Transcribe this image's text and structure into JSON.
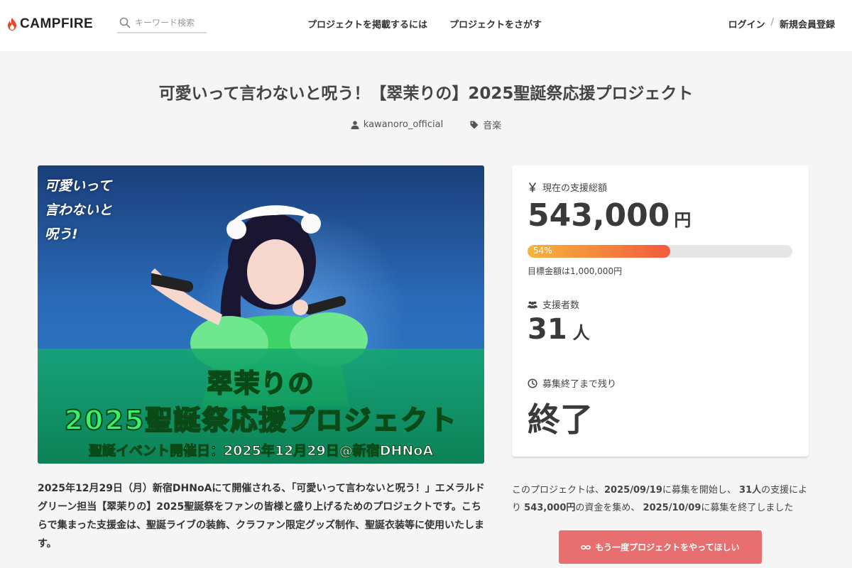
{
  "header": {
    "logo_text": "CAMPFIRE",
    "search_placeholder": "キーワード検索",
    "nav": {
      "post_project": "プロジェクトを掲載するには",
      "find_project": "プロジェクトをさがす"
    },
    "login": "ログイン",
    "separator": "/",
    "signup": "新規会員登録"
  },
  "project": {
    "title": "可愛いって言わないと呪う！【翠茉りの】2025聖誕祭応援プロジェクト",
    "owner": "kawanoro_official",
    "category": "音楽",
    "image": {
      "logo_text": [
        "可愛いって",
        "言わないと",
        "呪う!"
      ],
      "headline_line1": "翠茉りの",
      "headline_line2": "2025聖誕祭応援プロジェクト",
      "event_line": "聖誕イベント開催日：2025年12月29日@新宿DHNoA"
    },
    "description": "2025年12月29日（月）新宿DHNoAにて開催される、「可愛いって言わないと呪う！」エメラルドグリーン担当【翠茉りの】2025聖誕祭をファンの皆様と盛り上げるためのプロジェクトです。こちらで集まった支援金は、聖誕ライブの装飾、クラファン限定グッズ制作、聖誕衣装等に使用いたします。"
  },
  "stats": {
    "total_label": "現在の支援総額",
    "total_value": "543,000",
    "total_unit": "円",
    "progress_percent": 54,
    "progress_label": "54%",
    "goal_text": "目標金額は1,000,000円",
    "backers_label": "支援者数",
    "backers_value": "31",
    "backers_unit": "人",
    "remaining_label": "募集終了まで残り",
    "remaining_value": "終了"
  },
  "summary": {
    "prefix": "このプロジェクトは、",
    "start_date": "2025/09/19",
    "mid1": "に募集を開始し、",
    "backers": "31人",
    "mid2": "の支援により",
    "amount": "543,000円",
    "mid3": "の資金を集め、",
    "end_date": "2025/10/09",
    "suffix": "に募集を終了しました"
  },
  "cta": {
    "again_label": "もう一度プロジェクトをやってほしい"
  },
  "colors": {
    "progress_start": "#f7b43a",
    "progress_end": "#f25a3f",
    "cta": "#e76f6f",
    "logo_flame": "#e8472b"
  }
}
